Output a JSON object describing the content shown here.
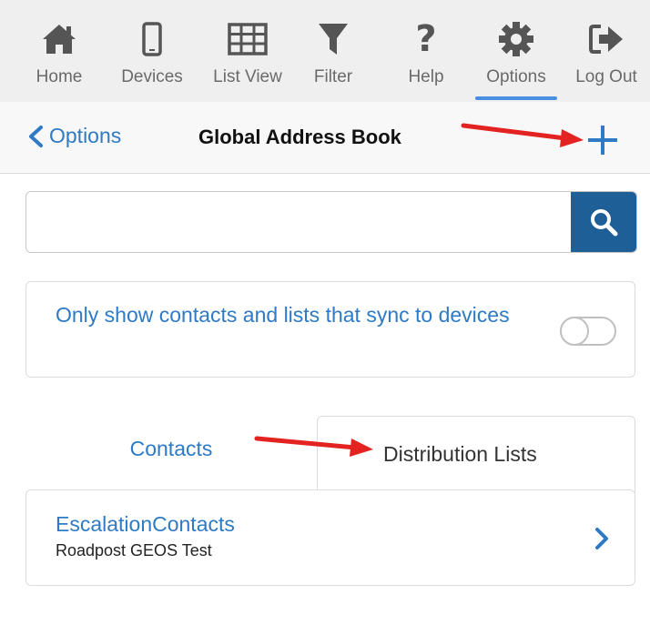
{
  "topbar": {
    "items": [
      {
        "label": "Home",
        "icon": "home-icon"
      },
      {
        "label": "Devices",
        "icon": "phone-icon"
      },
      {
        "label": "List View",
        "icon": "grid-icon"
      },
      {
        "label": "Filter",
        "icon": "filter-icon"
      },
      {
        "label": "Help",
        "icon": "help-icon"
      },
      {
        "label": "Options",
        "icon": "gear-icon",
        "active": true
      },
      {
        "label": "Log Out",
        "icon": "logout-icon"
      }
    ]
  },
  "header": {
    "back_label": "Options",
    "title": "Global Address Book",
    "add_icon": "plus-icon"
  },
  "search": {
    "value": "",
    "placeholder": "",
    "icon": "search-icon"
  },
  "sync_filter": {
    "label": "Only show contacts and lists that sync to devices",
    "enabled": false
  },
  "tabs": {
    "contacts_label": "Contacts",
    "distribution_label": "Distribution Lists",
    "active": "Distribution Lists"
  },
  "list": {
    "items": [
      {
        "title": "EscalationContacts",
        "subtitle": "Roadpost GEOS Test"
      }
    ]
  },
  "colors": {
    "accent": "#2e7ac4",
    "search_button": "#1f5f98",
    "active_underline": "#4a90e2",
    "annotation_arrow": "#e32222"
  }
}
